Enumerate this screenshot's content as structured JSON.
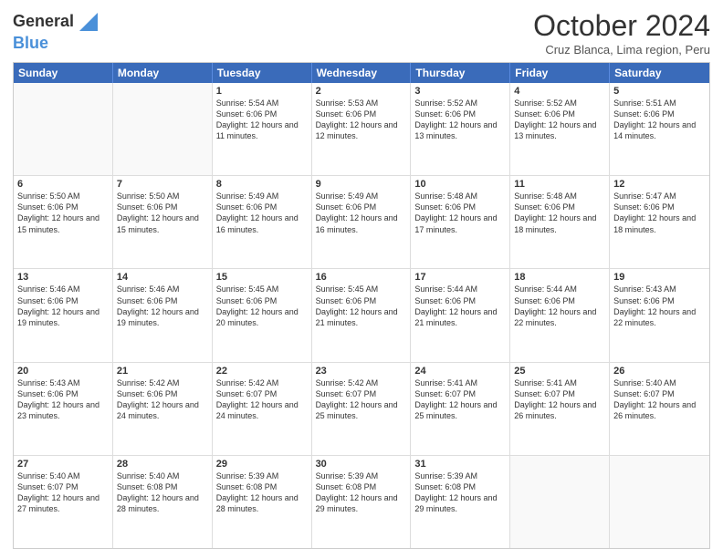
{
  "header": {
    "logo_general": "General",
    "logo_blue": "Blue",
    "month_title": "October 2024",
    "location": "Cruz Blanca, Lima region, Peru"
  },
  "days_of_week": [
    "Sunday",
    "Monday",
    "Tuesday",
    "Wednesday",
    "Thursday",
    "Friday",
    "Saturday"
  ],
  "weeks": [
    [
      {
        "num": "",
        "empty": true
      },
      {
        "num": "",
        "empty": true
      },
      {
        "num": "1",
        "sunrise": "5:54 AM",
        "sunset": "6:06 PM",
        "daylight": "12 hours and 11 minutes."
      },
      {
        "num": "2",
        "sunrise": "5:53 AM",
        "sunset": "6:06 PM",
        "daylight": "12 hours and 12 minutes."
      },
      {
        "num": "3",
        "sunrise": "5:52 AM",
        "sunset": "6:06 PM",
        "daylight": "12 hours and 13 minutes."
      },
      {
        "num": "4",
        "sunrise": "5:52 AM",
        "sunset": "6:06 PM",
        "daylight": "12 hours and 13 minutes."
      },
      {
        "num": "5",
        "sunrise": "5:51 AM",
        "sunset": "6:06 PM",
        "daylight": "12 hours and 14 minutes."
      }
    ],
    [
      {
        "num": "6",
        "sunrise": "5:50 AM",
        "sunset": "6:06 PM",
        "daylight": "12 hours and 15 minutes."
      },
      {
        "num": "7",
        "sunrise": "5:50 AM",
        "sunset": "6:06 PM",
        "daylight": "12 hours and 15 minutes."
      },
      {
        "num": "8",
        "sunrise": "5:49 AM",
        "sunset": "6:06 PM",
        "daylight": "12 hours and 16 minutes."
      },
      {
        "num": "9",
        "sunrise": "5:49 AM",
        "sunset": "6:06 PM",
        "daylight": "12 hours and 16 minutes."
      },
      {
        "num": "10",
        "sunrise": "5:48 AM",
        "sunset": "6:06 PM",
        "daylight": "12 hours and 17 minutes."
      },
      {
        "num": "11",
        "sunrise": "5:48 AM",
        "sunset": "6:06 PM",
        "daylight": "12 hours and 18 minutes."
      },
      {
        "num": "12",
        "sunrise": "5:47 AM",
        "sunset": "6:06 PM",
        "daylight": "12 hours and 18 minutes."
      }
    ],
    [
      {
        "num": "13",
        "sunrise": "5:46 AM",
        "sunset": "6:06 PM",
        "daylight": "12 hours and 19 minutes."
      },
      {
        "num": "14",
        "sunrise": "5:46 AM",
        "sunset": "6:06 PM",
        "daylight": "12 hours and 19 minutes."
      },
      {
        "num": "15",
        "sunrise": "5:45 AM",
        "sunset": "6:06 PM",
        "daylight": "12 hours and 20 minutes."
      },
      {
        "num": "16",
        "sunrise": "5:45 AM",
        "sunset": "6:06 PM",
        "daylight": "12 hours and 21 minutes."
      },
      {
        "num": "17",
        "sunrise": "5:44 AM",
        "sunset": "6:06 PM",
        "daylight": "12 hours and 21 minutes."
      },
      {
        "num": "18",
        "sunrise": "5:44 AM",
        "sunset": "6:06 PM",
        "daylight": "12 hours and 22 minutes."
      },
      {
        "num": "19",
        "sunrise": "5:43 AM",
        "sunset": "6:06 PM",
        "daylight": "12 hours and 22 minutes."
      }
    ],
    [
      {
        "num": "20",
        "sunrise": "5:43 AM",
        "sunset": "6:06 PM",
        "daylight": "12 hours and 23 minutes."
      },
      {
        "num": "21",
        "sunrise": "5:42 AM",
        "sunset": "6:06 PM",
        "daylight": "12 hours and 24 minutes."
      },
      {
        "num": "22",
        "sunrise": "5:42 AM",
        "sunset": "6:07 PM",
        "daylight": "12 hours and 24 minutes."
      },
      {
        "num": "23",
        "sunrise": "5:42 AM",
        "sunset": "6:07 PM",
        "daylight": "12 hours and 25 minutes."
      },
      {
        "num": "24",
        "sunrise": "5:41 AM",
        "sunset": "6:07 PM",
        "daylight": "12 hours and 25 minutes."
      },
      {
        "num": "25",
        "sunrise": "5:41 AM",
        "sunset": "6:07 PM",
        "daylight": "12 hours and 26 minutes."
      },
      {
        "num": "26",
        "sunrise": "5:40 AM",
        "sunset": "6:07 PM",
        "daylight": "12 hours and 26 minutes."
      }
    ],
    [
      {
        "num": "27",
        "sunrise": "5:40 AM",
        "sunset": "6:07 PM",
        "daylight": "12 hours and 27 minutes."
      },
      {
        "num": "28",
        "sunrise": "5:40 AM",
        "sunset": "6:08 PM",
        "daylight": "12 hours and 28 minutes."
      },
      {
        "num": "29",
        "sunrise": "5:39 AM",
        "sunset": "6:08 PM",
        "daylight": "12 hours and 28 minutes."
      },
      {
        "num": "30",
        "sunrise": "5:39 AM",
        "sunset": "6:08 PM",
        "daylight": "12 hours and 29 minutes."
      },
      {
        "num": "31",
        "sunrise": "5:39 AM",
        "sunset": "6:08 PM",
        "daylight": "12 hours and 29 minutes."
      },
      {
        "num": "",
        "empty": true
      },
      {
        "num": "",
        "empty": true
      }
    ]
  ],
  "labels": {
    "sunrise": "Sunrise:",
    "sunset": "Sunset:",
    "daylight": "Daylight:"
  }
}
